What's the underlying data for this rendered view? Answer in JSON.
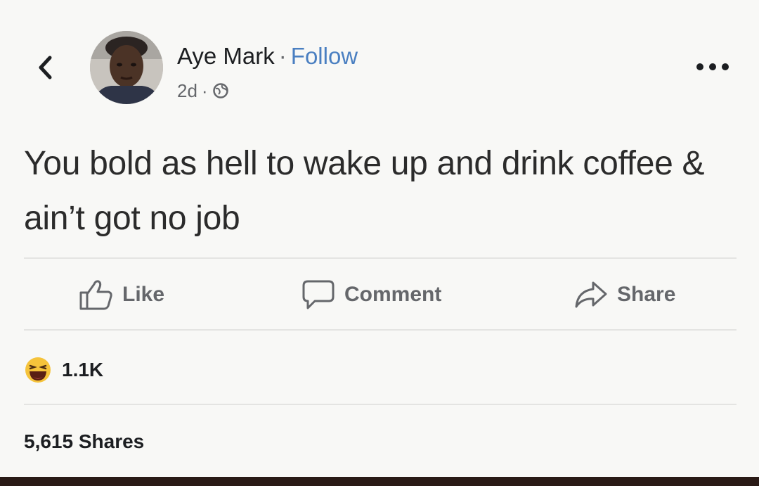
{
  "post": {
    "author": "Aye Mark",
    "separator": "·",
    "follow_label": "Follow",
    "time": "2d",
    "meta_separator": "·",
    "privacy_icon": "globe-icon",
    "text": "You bold as hell to wake up and drink coffee & ain’t got no job"
  },
  "actions": {
    "like_label": "Like",
    "comment_label": "Comment",
    "share_label": "Share"
  },
  "stats": {
    "reaction_icon": "haha-reaction-icon",
    "reaction_count": "1.1K",
    "shares": "5,615 Shares"
  },
  "colors": {
    "follow": "#4a7fc1",
    "muted": "#65676b",
    "bottom_bar": "#2a1a16"
  }
}
